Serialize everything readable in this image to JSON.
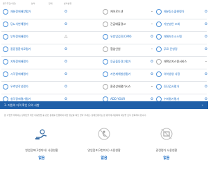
{
  "breadcrumb": [
    "평가추진(이론)",
    "분야",
    "장애",
    "분야분류"
  ],
  "rows": [
    {
      "c1": "재분장애배양평가",
      "m1": "o",
      "c2": "케어로드넷",
      "m2": "-",
      "c3": "제분장소출현평가",
      "m3": "o"
    },
    {
      "c1": "당뇨식변해평가",
      "m1": "o",
      "c2": "간급배출경고",
      "m2": "-",
      "c3": "가분방안 조회",
      "m3": "o"
    },
    {
      "c1": "부착장애배평가",
      "m1": "△",
      "c2": "유방암검진(CAM)",
      "m2": "o",
      "c3": "재해보조시스템",
      "m3": "o"
    },
    {
      "c1": "중증질환치료평가",
      "m1": "o",
      "c2": "협업인원",
      "m2": "-",
      "c3": "무료 운영정",
      "m3": "o"
    },
    {
      "c1": "지체장애배평가",
      "m1": "o",
      "c2": "응급출동경고평가",
      "m2": "o",
      "c3": "재택인지스원서비스",
      "m3": "-"
    },
    {
      "c1": "시각장애배평가",
      "m1": "o",
      "c2": "자연재해발생평가",
      "m2": "o",
      "c3": "의약생영 사정",
      "m3": "o"
    },
    {
      "c1": "우측방작성평가",
      "m1": "o",
      "c2": "환경상태평가시스",
      "m2": "-",
      "c3": "진단검사평가",
      "m3": "o"
    },
    {
      "c1": "청각장애평가평가",
      "m1": "o",
      "c2": "ADD YOUR",
      "m2": "o",
      "c3": "수화평가평가",
      "m3": "o"
    }
  ],
  "banner": {
    "title": "3. 지원의 자격 확인 유의 사항"
  },
  "description": "본 사업을 위해서는 장애인을 위한 이동방법 중 관련 분류를 진행하여 대한 정보를 확인 받아 주세요. 장애인평가는 본 평가에 지원하며 대상을 모두 만족해야 합니다.",
  "cards": [
    {
      "name": "영업점포(3천미터) 사용현황",
      "value": "없음"
    },
    {
      "name": "영업점포(3천미터) 사용현황",
      "value": "없음"
    },
    {
      "name": "관련평가 사용현황",
      "value": "없음"
    }
  ],
  "colors": {
    "accent": "#1f6fc5",
    "banner": "#1f5fa8"
  }
}
